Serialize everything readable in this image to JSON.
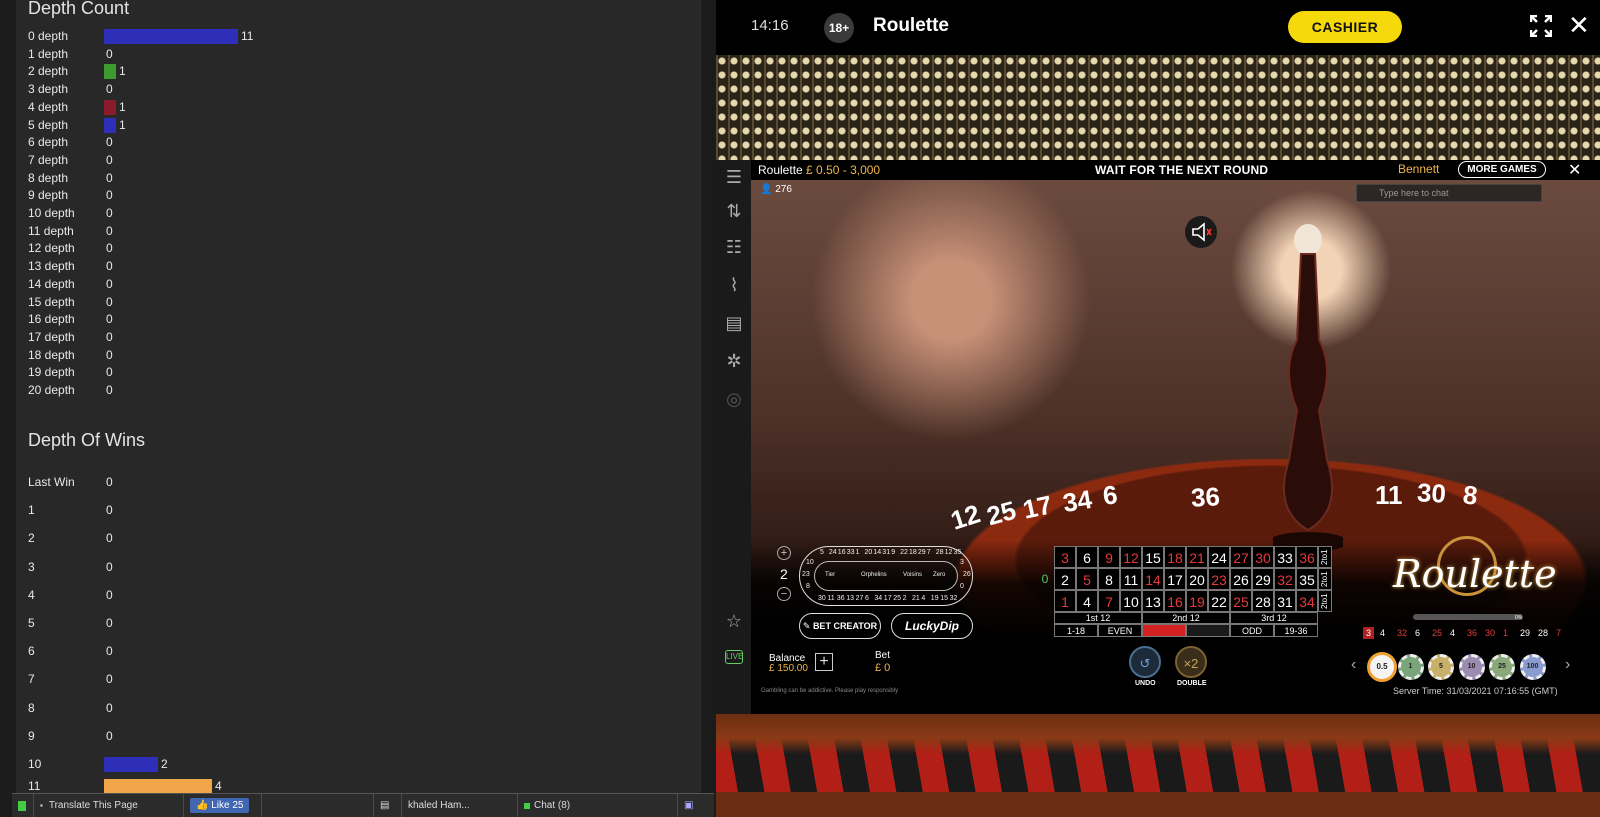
{
  "stats": {
    "depth_count_title": "Depth Count",
    "depth_rows": [
      {
        "label": "0 depth",
        "value": "11",
        "color": "#2e2fb8"
      },
      {
        "label": "1 depth",
        "value": "0"
      },
      {
        "label": "2 depth",
        "value": "1",
        "color": "#3c9a2e"
      },
      {
        "label": "3 depth",
        "value": "0"
      },
      {
        "label": "4 depth",
        "value": "1",
        "color": "#8b1a2b"
      },
      {
        "label": "5 depth",
        "value": "1",
        "color": "#2e2fb8"
      },
      {
        "label": "6 depth",
        "value": "0"
      },
      {
        "label": "7 depth",
        "value": "0"
      },
      {
        "label": "8 depth",
        "value": "0"
      },
      {
        "label": "9 depth",
        "value": "0"
      },
      {
        "label": "10 depth",
        "value": "0"
      },
      {
        "label": "11 depth",
        "value": "0"
      },
      {
        "label": "12 depth",
        "value": "0"
      },
      {
        "label": "13 depth",
        "value": "0"
      },
      {
        "label": "14 depth",
        "value": "0"
      },
      {
        "label": "15 depth",
        "value": "0"
      },
      {
        "label": "16 depth",
        "value": "0"
      },
      {
        "label": "17 depth",
        "value": "0"
      },
      {
        "label": "18 depth",
        "value": "0"
      },
      {
        "label": "19 depth",
        "value": "0"
      },
      {
        "label": "20 depth",
        "value": "0"
      }
    ],
    "depth_wins_title": "Depth Of Wins",
    "win_rows": [
      {
        "label": "Last Win",
        "value": "0"
      },
      {
        "label": "1",
        "value": "0"
      },
      {
        "label": "2",
        "value": "0"
      },
      {
        "label": "3",
        "value": "0"
      },
      {
        "label": "4",
        "value": "0"
      },
      {
        "label": "5",
        "value": "0"
      },
      {
        "label": "6",
        "value": "0"
      },
      {
        "label": "7",
        "value": "0"
      },
      {
        "label": "8",
        "value": "0"
      },
      {
        "label": "9",
        "value": "0"
      },
      {
        "label": "10",
        "value": "2",
        "color": "#2e2fb8"
      },
      {
        "label": "11",
        "value": "4",
        "color": "#f2a64a"
      }
    ]
  },
  "taskbar": {
    "translate": "Translate This Page",
    "like": "Like 25",
    "user": "khaled Ham...",
    "chat": "Chat (8)"
  },
  "game": {
    "time": "14:16",
    "age": "18+",
    "title": "Roulette",
    "cashier": "CASHIER",
    "table_name": "Roulette",
    "limits": "£ 0.50 - 3,000",
    "status": "WAIT FOR THE NEXT ROUND",
    "username": "Bennett",
    "more_games": "MORE GAMES",
    "players": "276",
    "chat_placeholder": "Type here to chat",
    "wheel_numbers": [
      "12",
      "25",
      "17",
      "34",
      "6",
      "36",
      "11",
      "30",
      "8"
    ],
    "racetrack": {
      "count": "2",
      "sections": [
        "Tier",
        "Orphelins",
        "Voisins",
        "Zero"
      ],
      "top": [
        "5",
        "24",
        "16",
        "33",
        "1",
        "20",
        "14",
        "31",
        "9",
        "22",
        "18",
        "29",
        "7",
        "28",
        "12",
        "35"
      ],
      "bottom": [
        "30",
        "11",
        "36",
        "13",
        "27",
        "6",
        "34",
        "17",
        "25",
        "2",
        "21",
        "4",
        "19",
        "15",
        "32"
      ],
      "left": [
        "10",
        "23",
        "8"
      ],
      "right": [
        "3",
        "26",
        "0"
      ]
    },
    "bet_creator": "BET CREATOR",
    "lucky_dip": "LuckyDip",
    "board": {
      "zero": "0",
      "rows": [
        [
          "3",
          "6",
          "9",
          "12",
          "15",
          "18",
          "21",
          "24",
          "27",
          "30",
          "33",
          "36"
        ],
        [
          "2",
          "5",
          "8",
          "11",
          "14",
          "17",
          "20",
          "23",
          "26",
          "29",
          "32",
          "35"
        ],
        [
          "1",
          "4",
          "7",
          "10",
          "13",
          "16",
          "19",
          "22",
          "25",
          "28",
          "31",
          "34"
        ]
      ],
      "red": [
        "3",
        "9",
        "12",
        "18",
        "21",
        "27",
        "30",
        "36",
        "5",
        "14",
        "23",
        "32",
        "1",
        "7",
        "16",
        "19",
        "25",
        "34"
      ],
      "column": "2to1",
      "dozens": [
        "1st 12",
        "2nd 12",
        "3rd 12"
      ],
      "outside": [
        "1-18",
        "EVEN",
        "",
        "",
        "ODD",
        "19-36"
      ]
    },
    "undo": "UNDO",
    "double": "DOUBLE",
    "double_icon": "×2",
    "balance_label": "Balance",
    "balance": "£ 150.00",
    "bet_label": "Bet",
    "bet": "£ 0",
    "gambling_note": "Gambling can be addictive. Please play responsibly",
    "logo": "Roulette",
    "progress_label": "0%",
    "history": [
      {
        "n": "3",
        "c": "#fff",
        "hl": true
      },
      {
        "n": "4",
        "c": "#fff"
      },
      {
        "n": "32",
        "c": "#e43a3a"
      },
      {
        "n": "6",
        "c": "#fff"
      },
      {
        "n": "25",
        "c": "#e43a3a"
      },
      {
        "n": "4",
        "c": "#fff"
      },
      {
        "n": "36",
        "c": "#e43a3a"
      },
      {
        "n": "30",
        "c": "#e43a3a"
      },
      {
        "n": "1",
        "c": "#e43a3a"
      },
      {
        "n": "29",
        "c": "#fff"
      },
      {
        "n": "28",
        "c": "#fff"
      },
      {
        "n": "7",
        "c": "#e43a3a"
      }
    ],
    "chips": [
      {
        "v": "0.5",
        "c": "#f4f4f4",
        "ring": "#f0a030"
      },
      {
        "v": "1",
        "c": "#7aa57a"
      },
      {
        "v": "5",
        "c": "#c9b06a"
      },
      {
        "v": "10",
        "c": "#9a8bb0"
      },
      {
        "v": "25",
        "c": "#8aa87a"
      },
      {
        "v": "100",
        "c": "#8a9bd0"
      }
    ],
    "server_time": "Server Time: 31/03/2021 07:16:55 (GMT)",
    "live_label": "LIVE"
  }
}
